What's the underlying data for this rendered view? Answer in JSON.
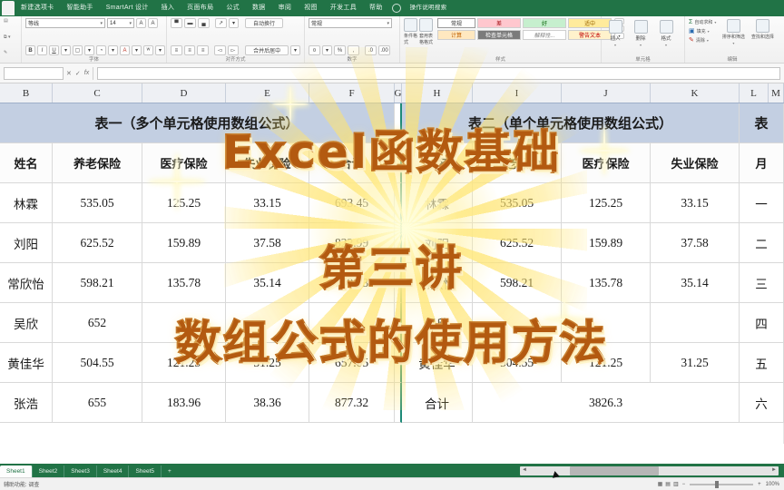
{
  "app": {
    "ribbon_tabs": [
      "新建选项卡",
      "智能助手",
      "SmartArt 设计",
      "插入",
      "页面布局",
      "公式",
      "数据",
      "审阅",
      "视图",
      "开发工具",
      "帮助",
      "操作说明搜索"
    ],
    "bulb_icon": "lightbulb-icon"
  },
  "ribbon": {
    "groups": [
      {
        "label": "字体",
        "font_name": "等线",
        "font_size": "14",
        "buttons": [
          "B",
          "I",
          "U",
          "框线",
          "填充",
          "字体颜色",
          "拼音"
        ],
        "grow_label": "A",
        "shrink_label": "A"
      },
      {
        "label": "对齐方式",
        "buttons": [
          "顶端对齐",
          "垂直居中",
          "底端对齐",
          "左对齐",
          "居中",
          "右对齐",
          "方向",
          "自动换行",
          "缩进减少",
          "缩进增加",
          "合并后居中"
        ]
      },
      {
        "label": "数字",
        "format": "常规",
        "buttons": [
          "会计数字格式",
          "百分比样式",
          "千位分隔",
          "增加小数位",
          "减少小数位"
        ]
      },
      {
        "label": "样式",
        "buttons": [
          "条件格式",
          "套用表格格式"
        ],
        "styles": [
          "常规",
          "差",
          "好",
          "适中",
          "计算",
          "检查单元格",
          "解释性...",
          "警告文本"
        ]
      },
      {
        "label": "单元格",
        "buttons": [
          "插入",
          "删除",
          "格式"
        ]
      },
      {
        "label": "编辑",
        "buttons": [
          "自动求和",
          "填充",
          "清除",
          "排序和筛选",
          "查找和选择"
        ]
      }
    ]
  },
  "formula_bar": {
    "name_box": "",
    "fx_label": "fx",
    "cancel": "✕",
    "confirm": "✓",
    "formula": ""
  },
  "grid": {
    "column_headers": [
      "B",
      "C",
      "D",
      "E",
      "F",
      "G",
      "H",
      "I",
      "J",
      "K",
      "L",
      "M"
    ],
    "table1_title": "表一（多个单元格使用数组公式）",
    "table2_title": "表二（单个单元格使用数组公式）",
    "table3_title": "表",
    "headers": {
      "name": "姓名",
      "pension": "养老保险",
      "medical": "医疗保险",
      "unemployment": "失业保险",
      "total": "合计",
      "unemployment2": "失业保险",
      "month": "月"
    },
    "table1": {
      "columns": [
        "姓名",
        "养老保险",
        "医疗保险",
        "失业保险",
        "合计"
      ],
      "rows": [
        {
          "name": "林霖",
          "pension": "535.05",
          "medical": "125.25",
          "unemployment": "33.15",
          "total": "693.45"
        },
        {
          "name": "刘阳",
          "pension": "625.52",
          "medical": "159.89",
          "unemployment": "37.58",
          "total": "822.99"
        },
        {
          "name": "常欣怡",
          "pension": "598.21",
          "medical": "135.78",
          "unemployment": "35.14",
          "total": "769.13"
        },
        {
          "name": "吴欣",
          "pension": "652",
          "medical": "",
          "unemployment": "",
          "total": ""
        },
        {
          "name": "黄佳华",
          "pension": "504.55",
          "medical": "121.25",
          "unemployment": "31.25",
          "total": "657.05"
        },
        {
          "name": "张浩",
          "pension": "655",
          "medical": "183.96",
          "unemployment": "38.36",
          "total": "877.32"
        }
      ]
    },
    "table2": {
      "columns": [
        "姓名",
        "养老保险",
        "医疗保险",
        "失业保险"
      ],
      "rows": [
        {
          "name": "林霖",
          "pension": "535.05",
          "medical": "125.25",
          "unemployment": "33.15"
        },
        {
          "name": "刘阳",
          "pension": "625.52",
          "medical": "159.89",
          "unemployment": "37.58"
        },
        {
          "name": "常欣怡",
          "pension": "598.21",
          "medical": "135.78",
          "unemployment": "35.14"
        },
        {
          "name": "吴欣",
          "pension": "",
          "medical": "",
          "unemployment": ""
        },
        {
          "name": "黄佳华",
          "pension": "504.55",
          "medical": "121.25",
          "unemployment": "31.25"
        },
        {
          "name": "合计",
          "pension": "3826.3",
          "medical": "",
          "unemployment": ""
        }
      ]
    },
    "table3": {
      "rows": [
        "月",
        "一",
        "二",
        "三",
        "四",
        "五",
        "六"
      ]
    }
  },
  "overlay": {
    "line1": "Excel函数基础",
    "line2": "第三讲",
    "line3": "数组公式的使用方法"
  },
  "sheets": {
    "tabs": [
      "Sheet1",
      "Sheet2",
      "Sheet3",
      "Sheet4",
      "Sheet5"
    ],
    "active": "Sheet1",
    "add_label": "+"
  },
  "status": {
    "left": "辅助功能: 调查",
    "view_label": "",
    "zoom": "100%"
  },
  "colors": {
    "excel_green": "#217346",
    "title_fill": "#c3cfe2",
    "overlay_orange": "#f7a521",
    "overlay_stroke": "#b35a10"
  }
}
